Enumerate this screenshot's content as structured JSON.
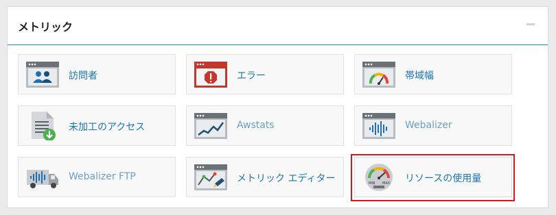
{
  "panel": {
    "title": "メトリック"
  },
  "tiles": [
    {
      "label": "訪問者",
      "icon": "visitors-icon"
    },
    {
      "label": "エラー",
      "icon": "error-icon"
    },
    {
      "label": "帯域幅",
      "icon": "bandwidth-icon"
    },
    {
      "label": "未加工のアクセス",
      "icon": "raw-access-icon"
    },
    {
      "label": "Awstats",
      "icon": "awstats-icon"
    },
    {
      "label": "Webalizer",
      "icon": "webalizer-icon"
    },
    {
      "label": "Webalizer FTP",
      "icon": "webalizer-ftp-icon"
    },
    {
      "label": "メトリック エディター",
      "icon": "metrics-editor-icon"
    },
    {
      "label": "リソースの使用量",
      "icon": "resource-usage-icon"
    }
  ],
  "gauge": {
    "min_label": "MIN",
    "max_label": "MAX"
  },
  "colors": {
    "accent": "#1c8dbf",
    "link": "#1a75b0",
    "highlight": "#d01b1b"
  }
}
